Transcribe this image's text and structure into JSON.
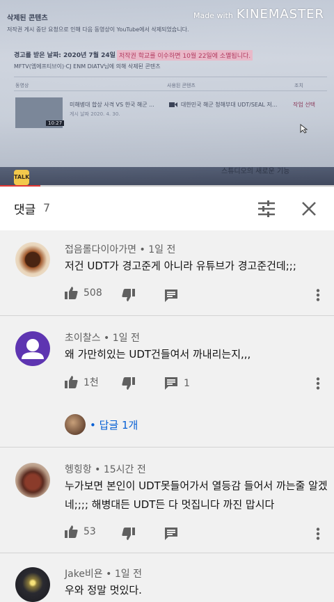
{
  "video": {
    "panel_title": "삭제된 콘텐츠",
    "panel_desc": "저작권 게시 중단 요청으로 인해 다음 동영상이 YouTube에서 삭제되었습니다.",
    "warning_label": "경고를 받은 날짜: 2020년 7월 24일",
    "warning_expire": "저작권 학교를 이수하면 10월 22일에 소멸됩니다.",
    "claimant_line": "MFTV(엠에프티브이)·CJ ENM DIATV님에 의해 삭제된 콘텐츠",
    "col_video": "동영상",
    "col_used": "사용된 콘텐츠",
    "col_action": "조치",
    "row_title": "미해병대 합상 사격 VS 한국 해군 ...",
    "row_date": "게시 날짜 2020. 4. 30.",
    "row_duration": "10:27",
    "row_used": "대한민국 해군 청해부대 UDT/SEAL 저...",
    "row_action": "작업 선택",
    "bottom_text": "스튜디오의 새로운 기능",
    "kakao_label": "TALK",
    "watermark_small": "Made with",
    "watermark_big": "KINEMASTER",
    "progress_fraction": 0.12
  },
  "header": {
    "title": "댓글",
    "count": "7",
    "filter_icon": "sort-filter-icon",
    "close_icon": "close-icon"
  },
  "comments": [
    {
      "author": "접음롤다이아가면",
      "time": "1일 전",
      "lines": [
        "저건 UDT가 경고준게 아니라 유튜브가 경고준건데;;;"
      ],
      "likes": "508",
      "replies_count": "",
      "reply_link": ""
    },
    {
      "author": "초이찰스",
      "time": "1일 전",
      "lines": [
        "왜 가만히있는 UDT건들여서 까내리는지,,,"
      ],
      "likes": "1천",
      "replies_count": "1",
      "reply_link": "• 답글 1개"
    },
    {
      "author": "헹힝항",
      "time": "15시간 전",
      "lines": [
        "누가보면 본인이 UDT못들어가서 열등감 들어서 까는줄 알겠",
        "네;;;; 해병대든 UDT든 다 멋집니다 까진 맙시다"
      ],
      "likes": "53",
      "replies_count": "",
      "reply_link": ""
    },
    {
      "author": "Jake비욘",
      "time": "1일 전",
      "lines": [
        "우와 정말 멋있다."
      ],
      "likes": "",
      "replies_count": "",
      "reply_link": ""
    }
  ],
  "colors": {
    "accent_link": "#065fd4",
    "progress": "#e53935",
    "avatar_purple": "#5e35b1"
  }
}
